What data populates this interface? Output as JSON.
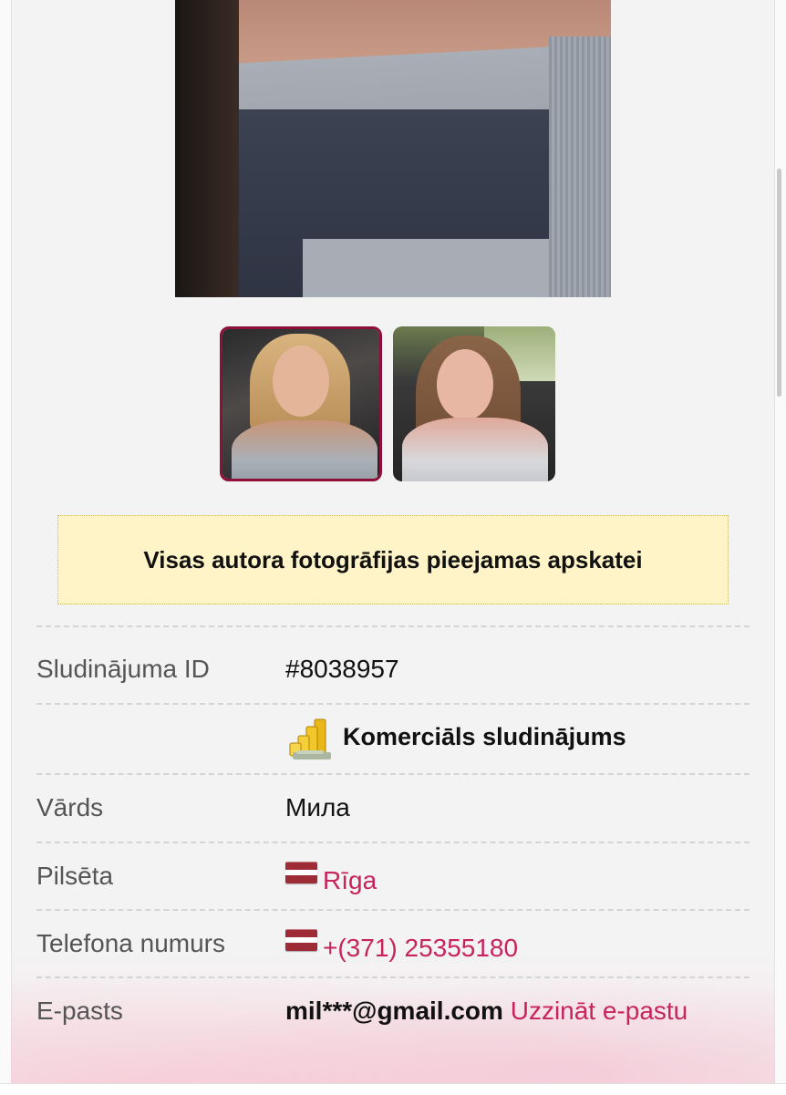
{
  "notice": {
    "text": "Visas autora fotogrāfijas pieejamas apskatei"
  },
  "info": {
    "id_label": "Sludinājuma ID",
    "id_value": "#8038957",
    "commercial_label": "Komerciāls sludinājums",
    "commercial_icon": "coins-icon",
    "name_label": "Vārds",
    "name_value": "Мила",
    "city_label": "Pilsēta",
    "city_value": "Rīga",
    "phone_label": "Telefona numurs",
    "phone_value": "+(371) 25355180",
    "email_label": "E-pasts",
    "email_value": "mil***@gmail.com",
    "email_link": "Uzzināt e-pastu",
    "flag_icon": "latvia-flag-icon"
  },
  "colors": {
    "accent": "#c7245e",
    "thumb_selected_border": "#8e1039",
    "notice_bg": "#fff4c8"
  }
}
